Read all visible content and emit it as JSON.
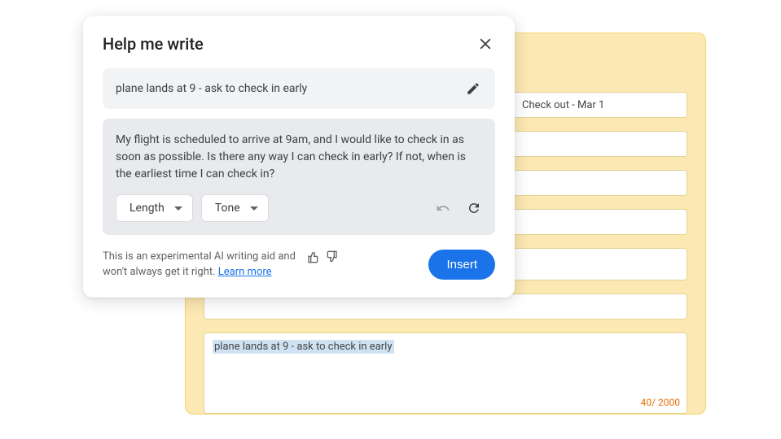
{
  "modal": {
    "title": "Help me write",
    "prompt": "plane lands at 9 - ask to check in early",
    "suggestion": "My flight is scheduled to arrive at 9am, and I would like to check in as soon as possible. Is there any way I can check in early? If not, when is the earliest time I can check in?",
    "length_label": "Length",
    "tone_label": "Tone",
    "disclaimer_part1": "This is an experimental AI writing aid and",
    "disclaimer_part2": "won't always get it right.",
    "learn_more": "Learn more",
    "insert_label": "Insert"
  },
  "background": {
    "checkout_label": "Check out - Mar 1",
    "textarea_text": "plane lands at 9 - ask to check in early",
    "char_count": "40/ 2000"
  }
}
